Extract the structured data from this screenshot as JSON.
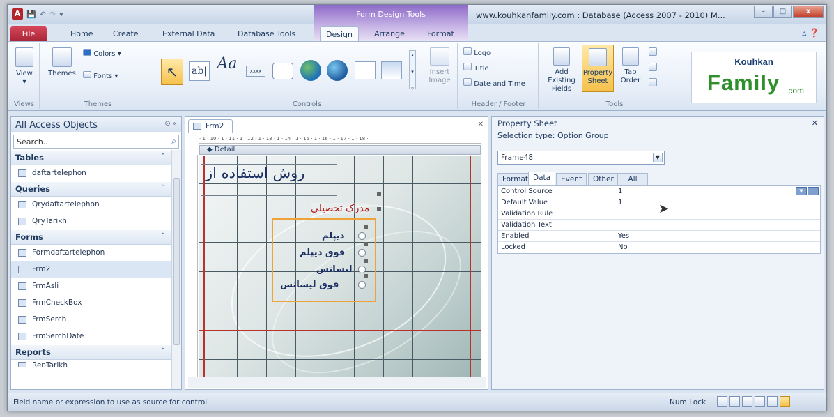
{
  "window": {
    "title": "www.kouhkanfamily.com : Database (Access 2007 - 2010) M...",
    "context_tab": "Form Design Tools",
    "controls": [
      "–",
      "□",
      "x"
    ]
  },
  "ribbon_tabs": [
    "File",
    "Home",
    "Create",
    "External Data",
    "Database Tools",
    "Design",
    "Arrange",
    "Format"
  ],
  "active_tab": "Design",
  "ribbon": {
    "views": {
      "label": "Views",
      "view": "View"
    },
    "themes": {
      "label": "Themes",
      "themes": "Themes",
      "colors": "Colors",
      "fonts": "Fonts"
    },
    "controls": {
      "label": "Controls",
      "text_box": "ab|",
      "label_ctrl": "Aa",
      "button": "xxxx",
      "insert_image": "Insert Image"
    },
    "header_footer": {
      "label": "Header / Footer",
      "logo": "Logo",
      "title": "Title",
      "date_time": "Date and Time"
    },
    "tools": {
      "label": "Tools",
      "add_existing": "Add Existing Fields",
      "property_sheet": "Property Sheet",
      "tab_order": "Tab Order"
    }
  },
  "brand": {
    "top": "Kouhkan",
    "main": "Family",
    "suffix": ".com"
  },
  "nav": {
    "title": "All Access Objects",
    "search_placeholder": "Search...",
    "categories": [
      {
        "name": "Tables",
        "items": [
          "daftartelephon"
        ]
      },
      {
        "name": "Queries",
        "items": [
          "Qrydaftartelephon",
          "QryTarikh"
        ]
      },
      {
        "name": "Forms",
        "items": [
          "Formdaftartelephon",
          "Frm2",
          "FrmAsli",
          "FrmCheckBox",
          "FrmSerch",
          "FrmSerchDate"
        ]
      },
      {
        "name": "Reports",
        "items": [
          "RepTarikh"
        ]
      }
    ],
    "selected": "Frm2"
  },
  "document": {
    "tab": "Frm2",
    "section": "Detail",
    "ruler": "· 1 · 10 · 1 · 11 · 1 · 12 · 1 · 13 · 1 · 14 · 1 · 15 · 1 · 16 · 1 · 17 · 1 · 18 ·",
    "form_label": "روش استفاده از",
    "frame_title": "مدرک تحصیلی",
    "options": [
      "دیپلم",
      "فوق دیپلم",
      "لیسانس",
      "فوق لیسانس"
    ]
  },
  "property_sheet": {
    "title": "Property Sheet",
    "selection_type": "Selection type:  Option Group",
    "object": "Frame48",
    "tabs": [
      "Format",
      "Data",
      "Event",
      "Other",
      "All"
    ],
    "active_tab": "Data",
    "rows": [
      {
        "name": "Control Source",
        "value": "1"
      },
      {
        "name": "Default Value",
        "value": "1"
      },
      {
        "name": "Validation Rule",
        "value": ""
      },
      {
        "name": "Validation Text",
        "value": ""
      },
      {
        "name": "Enabled",
        "value": "Yes"
      },
      {
        "name": "Locked",
        "value": "No"
      }
    ]
  },
  "status": {
    "message": "Field name or expression to use as source for control",
    "numlock": "Num Lock"
  }
}
